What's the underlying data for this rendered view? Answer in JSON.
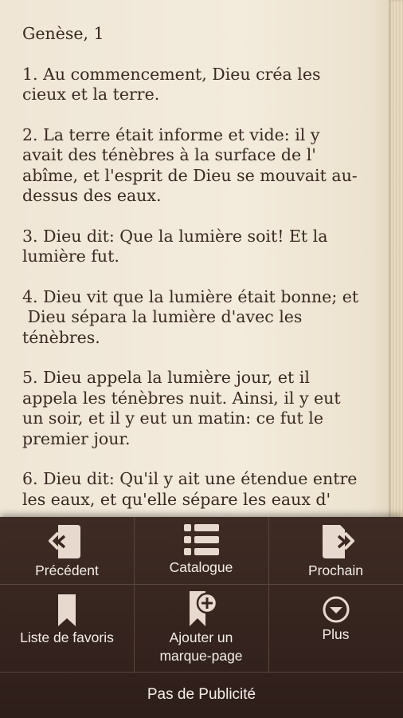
{
  "reader": {
    "chapter_title": "Genèse, 1",
    "verses": [
      {
        "line1": "1. Au commencement, Dieu créa les",
        "line2": "cieux et la terre."
      },
      {
        "line1": "2. La terre était informe et vide: il y",
        "line2": "avait des ténèbres à la surface de l'",
        "line3": "abîme, et l'esprit de Dieu se mouvait au-",
        "line4": "dessus des eaux."
      },
      {
        "line1": "3. Dieu dit: Que la lumière soit! Et la",
        "line2": "lumière fut."
      },
      {
        "line1": "4. Dieu vit que la lumière était bonne; et",
        "line2": " Dieu sépara la lumière d'avec les",
        "line3": "ténèbres."
      },
      {
        "line1": "5. Dieu appela la lumière jour, et il",
        "line2": "appela les ténèbres nuit. Ainsi, il y eut",
        "line3": "un soir, et il y eut un matin: ce fut le",
        "line4": "premier jour."
      },
      {
        "line1": "6. Dieu dit: Qu'il y ait une étendue entre",
        "line2": "les eaux, et qu'elle sépare les eaux d'"
      }
    ]
  },
  "menu": {
    "previous": {
      "label": "Précédent",
      "icon": "page-prev-icon"
    },
    "catalogue": {
      "label": "Catalogue",
      "icon": "list-icon"
    },
    "next": {
      "label": "Prochain",
      "icon": "page-next-icon"
    },
    "favorites": {
      "label": "Liste de favoris",
      "icon": "bookmark-icon"
    },
    "add_bookmark": {
      "line1": "Ajouter un",
      "line2": "marque-page",
      "icon": "bookmark-add-icon"
    },
    "more": {
      "label": "Plus",
      "icon": "chevron-circle-icon"
    },
    "no_ads": "Pas de Publicité",
    "colors": {
      "background": "#3a2620",
      "text": "#f4eee8",
      "icon": "#e8d9cf"
    }
  }
}
